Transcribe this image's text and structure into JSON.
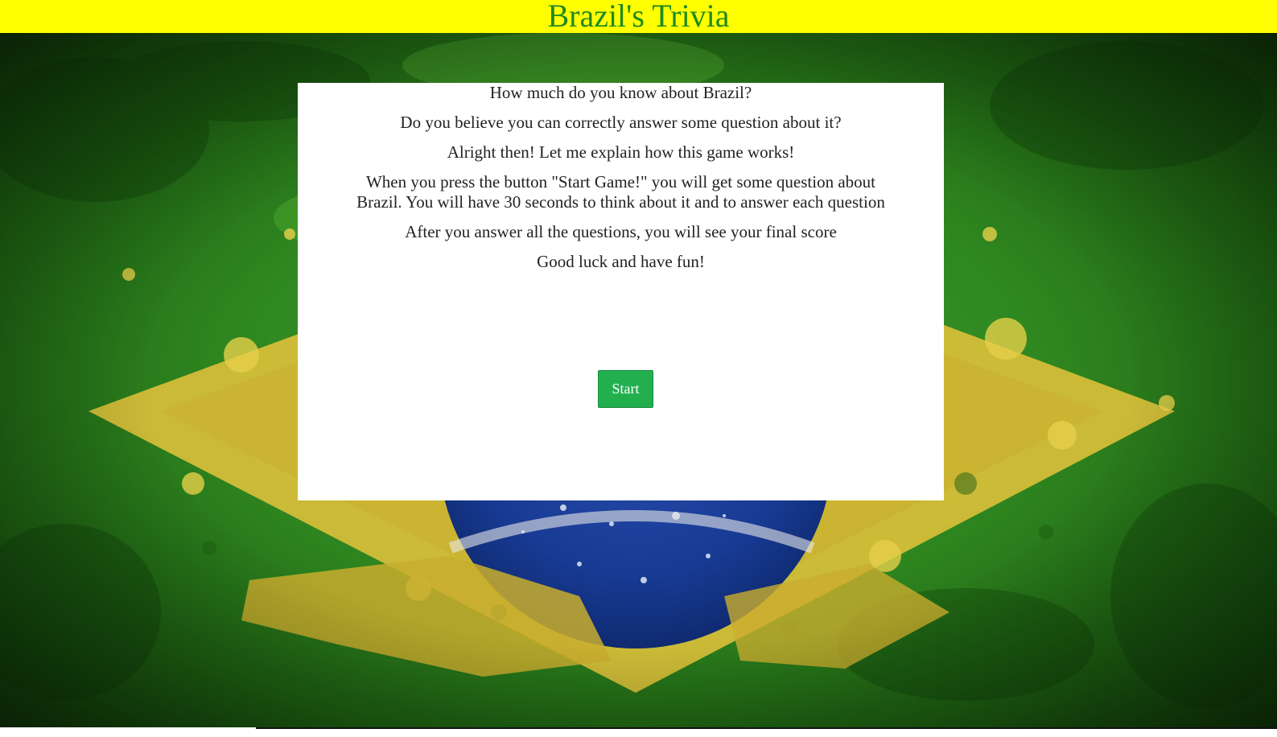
{
  "header": {
    "title": "Brazil's Trivia"
  },
  "intro": {
    "lines": [
      "How much do you know about Brazil?",
      "Do you believe you can correctly answer some question about it?",
      "Alright then! Let me explain how this game works!",
      "When you press the button \"Start Game!\" you will get some question about Brazil. You will have 30 seconds to think about it and to answer each question",
      "After you answer all the questions, you will see your final score",
      "Good luck and have fun!"
    ]
  },
  "start_button": {
    "label": "Start"
  },
  "colors": {
    "header_bg": "#ffff00",
    "title": "#1f8a1f",
    "button_bg": "#22b04f",
    "panel_bg": "#ffffff"
  }
}
